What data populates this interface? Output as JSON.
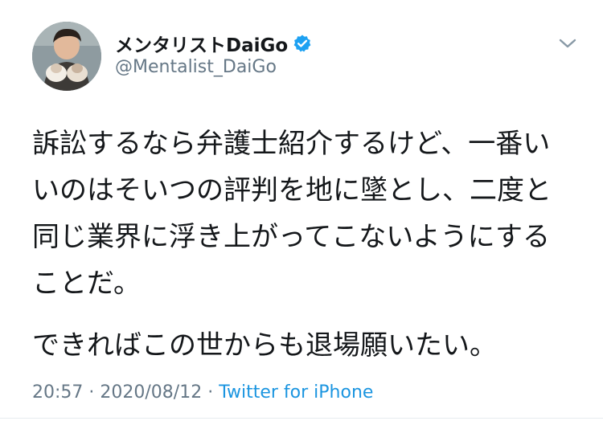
{
  "user": {
    "display_name": "メンタリストDaiGo",
    "handle": "@Mentalist_DaiGo",
    "verified": true,
    "avatar_icon": "profile-photo"
  },
  "tweet": {
    "paragraphs": [
      "訴訟するなら弁護士紹介するけど、一番い\nいのはそいつの評判を地に墜とし、二度と\n同じ業界に浮き上がってこないようにする\nことだ。",
      "できればこの世からも退場願いたい。"
    ]
  },
  "meta": {
    "time": "20:57",
    "separator": " · ",
    "date": "2020/08/12",
    "source": "Twitter for iPhone"
  },
  "colors": {
    "verified_badge": "#1da1f2",
    "secondary_text": "#657786",
    "link": "#1b95e0"
  },
  "icons": {
    "verified": "verified-badge-icon",
    "menu": "chevron-down-icon"
  }
}
